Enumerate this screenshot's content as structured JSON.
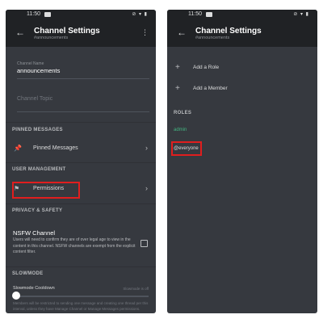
{
  "colors": {
    "background": "#36393f",
    "bar": "#202225",
    "highlight": "#e01e1e",
    "admin_role": "#43b581"
  },
  "left": {
    "status": {
      "time": "11:50",
      "icons": "⊘ ▾ ▮"
    },
    "header": {
      "title": "Channel Settings",
      "subtitle": "#announcements",
      "back_icon": "arrow-left-icon",
      "menu_icon": "more-vertical-icon"
    },
    "channel_name": {
      "label": "Channel Name",
      "value": "announcements"
    },
    "channel_topic": {
      "placeholder": "Channel Topic"
    },
    "pinned_section": "PINNED MESSAGES",
    "pinned_item": {
      "label": "Pinned Messages",
      "icon": "pin-icon"
    },
    "user_mgmt_section": "USER MANAGEMENT",
    "permissions_item": {
      "label": "Permissions",
      "icon": "flag-icon"
    },
    "privacy_section": "PRIVACY & SAFETY",
    "nsfw": {
      "title": "NSFW Channel",
      "description": "Users will need to confirm they are of over legal age to view in the content in this channel. NSFW channels are exempt from the explicit content filter.",
      "checked": false
    },
    "slowmode_section": "SLOWMODE",
    "slowmode": {
      "label": "Slowmode Cooldown",
      "value": "Slowmode is off",
      "description": "Members will be restricted to sending one message and creating one thread per this interval, unless they have Manage Channel or Manage Messages permissions."
    }
  },
  "right": {
    "status": {
      "time": "11:50",
      "icons": "⊘ ▾ ▮"
    },
    "header": {
      "title": "Channel Settings",
      "subtitle": "#announcements",
      "back_icon": "arrow-left-icon"
    },
    "add_role": "Add a Role",
    "add_member": "Add a Member",
    "roles_section": "ROLES",
    "roles": [
      "admin",
      "@everyone"
    ]
  }
}
